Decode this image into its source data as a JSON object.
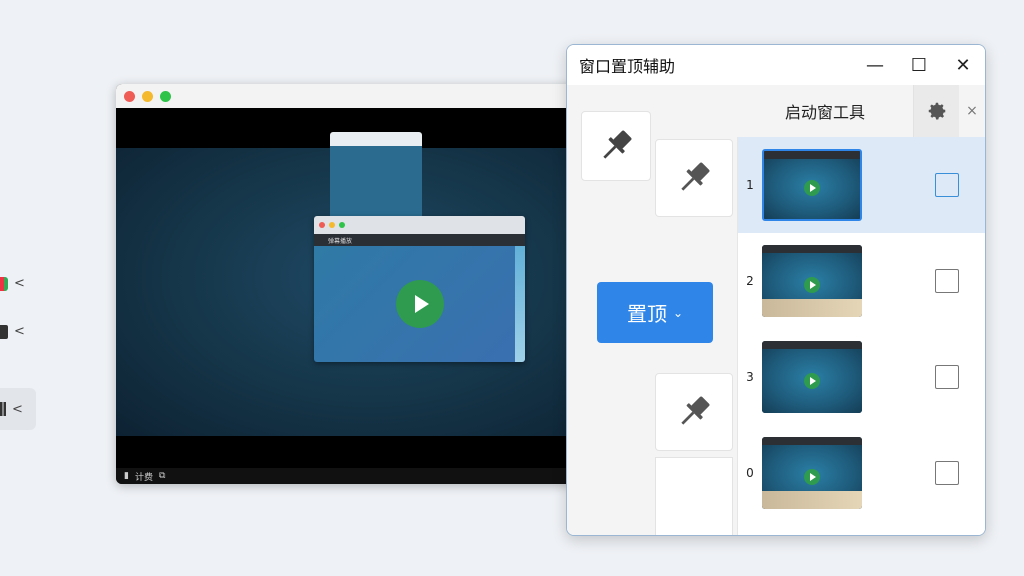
{
  "sidebar": {
    "items": [
      {
        "icon": "app-icon",
        "chevron": "<"
      },
      {
        "icon": "monitor-icon",
        "chevron": "<"
      },
      {
        "icon": "chart-icon",
        "chevron": "<"
      }
    ]
  },
  "player": {
    "mini_title": "弹幕播放",
    "bottom_text": "计费"
  },
  "helper": {
    "title": "窗口置顶辅助",
    "window_controls": {
      "minimize": "—",
      "maximize": "☐",
      "close": "✕"
    },
    "tool_title": "启动窗工具",
    "tool_close": "×",
    "pin_button_label": "置顶",
    "pin_button_caret": "⌄",
    "rows": [
      {
        "number": "1",
        "selected": true,
        "checked": false
      },
      {
        "number": "2",
        "selected": false,
        "checked": false
      },
      {
        "number": "3",
        "selected": false,
        "checked": false
      },
      {
        "number": "0",
        "selected": false,
        "checked": false
      }
    ]
  },
  "colors": {
    "accent": "#2f86e8",
    "selected_row": "#dde9f7",
    "play_green": "#2e9b4e"
  }
}
